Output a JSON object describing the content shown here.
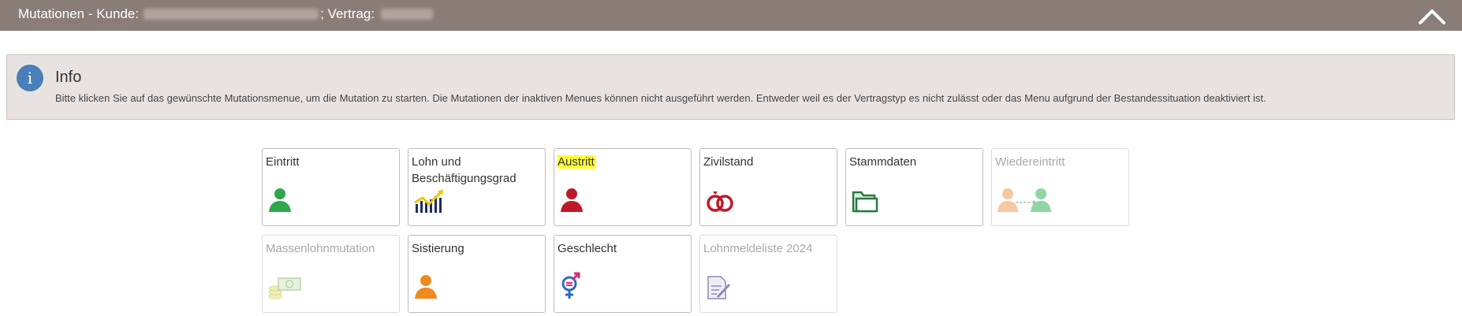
{
  "header": {
    "title_prefix": "Mutationen - Kunde:",
    "title_contract": "; Vertrag:"
  },
  "info": {
    "title": "Info",
    "text": "Bitte klicken Sie auf das gewünschte Mutationsmenue, um die Mutation zu starten. Die Mutationen der inaktiven Menues können nicht ausgeführt werden. Entweder weil es der Vertragstyp es nicht zulässt oder das Menu aufgrund der Bestandessituation deaktiviert ist."
  },
  "tiles": [
    {
      "label": "Eintritt",
      "icon": "person-green-icon",
      "enabled": true
    },
    {
      "label": "Lohn und Beschäftigungsgrad",
      "icon": "chart-growth-icon",
      "enabled": true
    },
    {
      "label": "Austritt",
      "icon": "person-red-icon",
      "enabled": true,
      "highlighted": true
    },
    {
      "label": "Zivilstand",
      "icon": "wedding-rings-icon",
      "enabled": true
    },
    {
      "label": "Stammdaten",
      "icon": "folder-icon",
      "enabled": true
    },
    {
      "label": "Wiedereintritt",
      "icon": "person-transfer-icon",
      "enabled": false
    },
    {
      "label": "Massenlohnmutation",
      "icon": "money-stack-icon",
      "enabled": false
    },
    {
      "label": "Sistierung",
      "icon": "person-orange-icon",
      "enabled": true
    },
    {
      "label": "Geschlecht",
      "icon": "gender-icon",
      "enabled": true
    },
    {
      "label": "Lohnmeldeliste 2024",
      "icon": "document-signature-icon",
      "enabled": false
    }
  ],
  "colors": {
    "header_bg": "#8a7d77",
    "info_bg": "#e8e3e1",
    "info_icon": "#4a7fb9",
    "highlight": "#ffff33"
  }
}
